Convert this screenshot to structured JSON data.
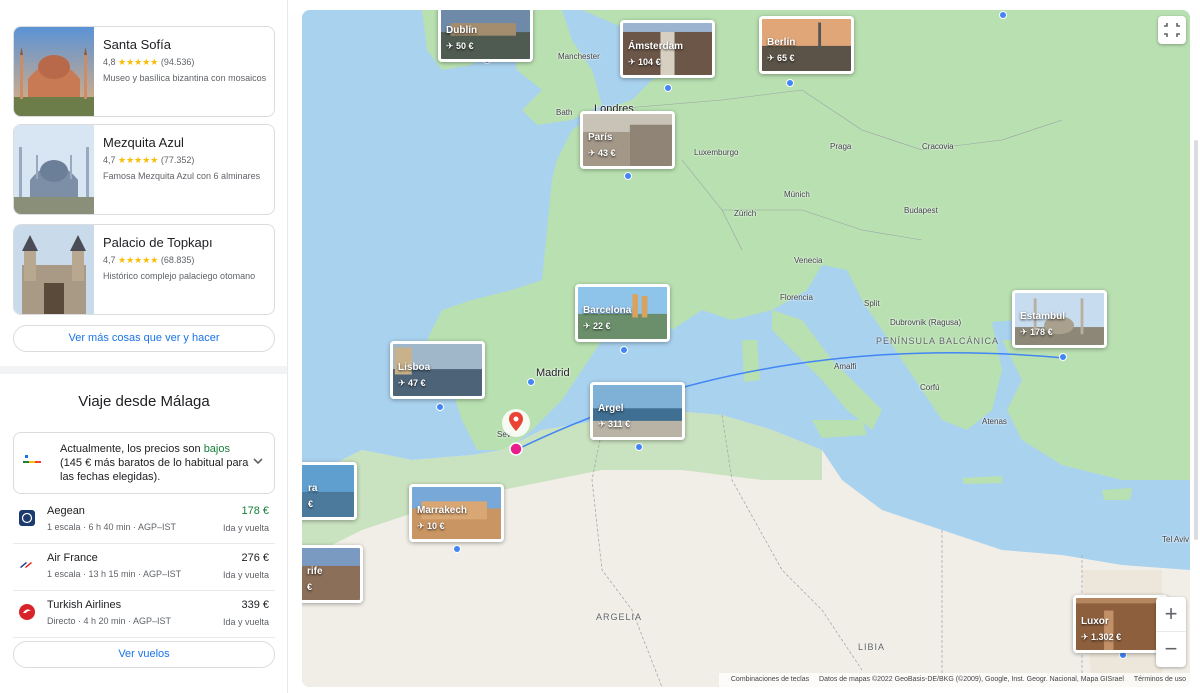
{
  "attractions": [
    {
      "name": "Santa Sofía",
      "rating": "4,8",
      "stars": "★★★★★",
      "reviews": "(94.536)",
      "desc": "Museo y basílica bizantina con mosaicos"
    },
    {
      "name": "Mezquita Azul",
      "rating": "4,7",
      "stars": "★★★★★",
      "reviews": "(77.352)",
      "desc": "Famosa Mezquita Azul con 6 alminares"
    },
    {
      "name": "Palacio de Topkapı",
      "rating": "4,7",
      "stars": "★★★★★",
      "reviews": "(68.835)",
      "desc": "Histórico complejo palaciego otomano"
    }
  ],
  "see_more_label": "Ver más cosas que ver y hacer",
  "trip": {
    "title": "Viaje desde Málaga",
    "price_line_1": "Actualmente, los precios son ",
    "price_low": "bajos",
    "price_line_2": "(145 € más baratos de lo habitual para las fechas elegidas).",
    "view_flights_label": "Ver vuelos"
  },
  "flights": [
    {
      "airline": "Aegean",
      "details": "1 escala · 6 h 40 min · AGP–IST",
      "price": "178 €",
      "trip_type": "Ida y vuelta",
      "cheapest": true
    },
    {
      "airline": "Air France",
      "details": "1 escala · 13 h 15 min · AGP–IST",
      "price": "276 €",
      "trip_type": "Ida y vuelta",
      "cheapest": false
    },
    {
      "airline": "Turkish Airlines",
      "details": "Directo · 4 h 20 min · AGP–IST",
      "price": "339 €",
      "trip_type": "Ida y vuelta",
      "cheapest": false
    }
  ],
  "map": {
    "destinations": [
      {
        "name": "Dublín",
        "price": "50 €"
      },
      {
        "name": "Ámsterdam",
        "price": "104 €"
      },
      {
        "name": "Berlín",
        "price": "65 €"
      },
      {
        "name": "París",
        "price": "43 €"
      },
      {
        "name": "Barcelona",
        "price": "22 €"
      },
      {
        "name": "Estambul",
        "price": "178 €"
      },
      {
        "name": "Lisboa",
        "price": "47 €"
      },
      {
        "name": "Argel",
        "price": "311 €"
      },
      {
        "name": "Marrakech",
        "price": "10 €"
      },
      {
        "name": "Luxor",
        "price": "1.302 €"
      },
      {
        "name": "ra",
        "price": "€"
      },
      {
        "name": "rife",
        "price": "€"
      }
    ],
    "cities": {
      "manchester": "Manchester",
      "bath": "Bath",
      "londres": "Londres",
      "luxemburgo": "Luxemburgo",
      "praga": "Praga",
      "cracovia": "Cracovia",
      "munich": "Múnich",
      "zurich": "Zúrich",
      "budapest": "Budapest",
      "venecia": "Venecia",
      "florencia": "Florencia",
      "split": "Split",
      "dubrovnik": "Dubrovnik (Ragusa)",
      "madrid": "Madrid",
      "amalfi": "Amalfi",
      "corfu": "Corfú",
      "atenas": "Atenas",
      "sevilla": "Sev",
      "tel_aviv": "Tel Aviv"
    },
    "regions": {
      "balcanica": "PENÍNSULA BALCÁNICA",
      "argelia": "ARGELIA",
      "libia": "LIBIA"
    },
    "attribution": {
      "shortcuts": "Combinaciones de teclas",
      "data": "Datos de mapas ©2022 GeoBasis-DE/BKG (©2009), Google, Inst. Geogr. Nacional, Mapa GISrael",
      "terms": "Términos de uso"
    },
    "colors": {
      "water": "#a9d2ef",
      "land": "#b9e0b1",
      "desert": "#f1eee7",
      "route": "#4285f4",
      "origin": "#e91e8c"
    }
  }
}
